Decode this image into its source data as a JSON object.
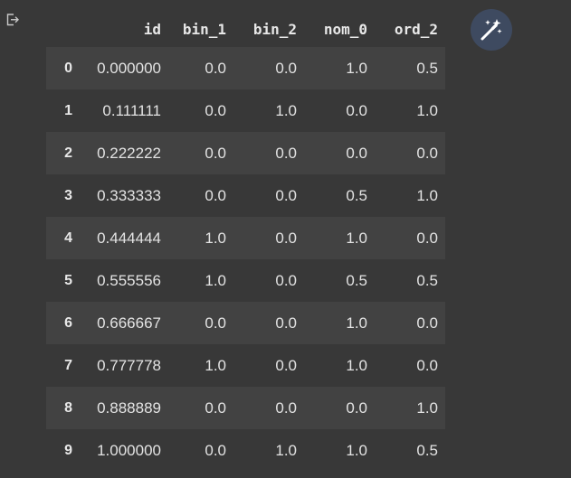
{
  "output": {
    "icon": "output-redirect-icon"
  },
  "toolbar": {
    "magic_icon": "magic-wand-icon",
    "accent": "#3e4a60"
  },
  "table": {
    "columns": [
      "id",
      "bin_1",
      "bin_2",
      "nom_0",
      "ord_2"
    ],
    "rows": [
      {
        "index": "0",
        "values": [
          "0.000000",
          "0.0",
          "0.0",
          "1.0",
          "0.5"
        ]
      },
      {
        "index": "1",
        "values": [
          "0.111111",
          "0.0",
          "1.0",
          "0.0",
          "1.0"
        ]
      },
      {
        "index": "2",
        "values": [
          "0.222222",
          "0.0",
          "0.0",
          "0.0",
          "0.0"
        ]
      },
      {
        "index": "3",
        "values": [
          "0.333333",
          "0.0",
          "0.0",
          "0.5",
          "1.0"
        ]
      },
      {
        "index": "4",
        "values": [
          "0.444444",
          "1.0",
          "0.0",
          "1.0",
          "0.0"
        ]
      },
      {
        "index": "5",
        "values": [
          "0.555556",
          "1.0",
          "0.0",
          "0.5",
          "0.5"
        ]
      },
      {
        "index": "6",
        "values": [
          "0.666667",
          "0.0",
          "0.0",
          "1.0",
          "0.0"
        ]
      },
      {
        "index": "7",
        "values": [
          "0.777778",
          "1.0",
          "0.0",
          "1.0",
          "0.0"
        ]
      },
      {
        "index": "8",
        "values": [
          "0.888889",
          "0.0",
          "0.0",
          "0.0",
          "1.0"
        ]
      },
      {
        "index": "9",
        "values": [
          "1.000000",
          "0.0",
          "1.0",
          "1.0",
          "0.5"
        ]
      }
    ]
  }
}
